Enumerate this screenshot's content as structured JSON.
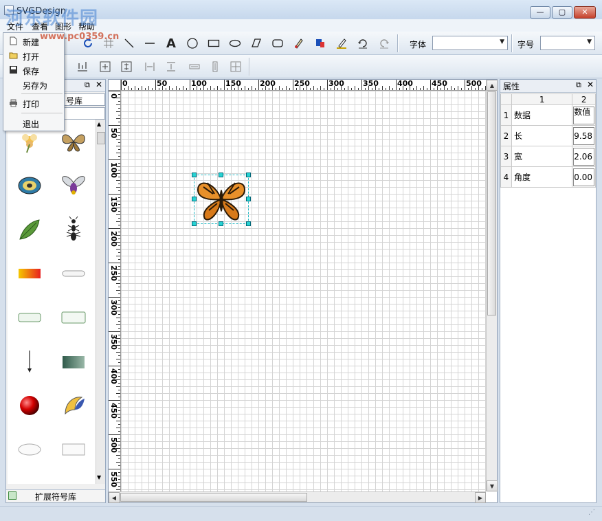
{
  "window": {
    "title": "SVGDesign",
    "min_glyph": "—",
    "max_glyph": "▢",
    "close_glyph": "✕"
  },
  "watermark": {
    "text": "河东软件园",
    "url": "www.pc0359.cn"
  },
  "menubar": {
    "items": [
      "文件",
      "查看",
      "图形",
      "帮助"
    ]
  },
  "toolbar": {
    "font_label": "字体",
    "font_value": "",
    "size_label": "字号",
    "size_value": ""
  },
  "file_menu": {
    "items": [
      {
        "label": "新建",
        "icon": "new-file-icon"
      },
      {
        "label": "打开",
        "icon": "open-folder-icon"
      },
      {
        "label": "保存",
        "icon": "save-disk-icon"
      },
      {
        "label": "另存为",
        "icon": ""
      },
      {
        "label": "打印",
        "icon": "printer-icon"
      },
      {
        "label": "退出",
        "icon": ""
      }
    ]
  },
  "library": {
    "tab_label": "号库",
    "footer_label": "扩展符号库",
    "symbols": [
      "flower",
      "butterfly",
      "disc",
      "fly",
      "leaf",
      "ant",
      "gradient-bar",
      "rounded-button",
      "small-button",
      "message-button",
      "arrow-down",
      "dark-green-rect",
      "red-ball",
      "swirl-graphic",
      "ellipse",
      "rectangle"
    ]
  },
  "rulers": {
    "h_ticks": [
      "0",
      "50",
      "100",
      "150",
      "200",
      "250",
      "300",
      "350",
      "400",
      "450",
      "500"
    ],
    "v_ticks": [
      "0",
      "50",
      "100",
      "150",
      "200",
      "250",
      "300",
      "350",
      "400",
      "450",
      "500",
      "550"
    ]
  },
  "properties": {
    "title": "属性",
    "col_headers": [
      "1",
      "2"
    ],
    "rows": [
      {
        "num": "1",
        "name": "数据",
        "value": "数值"
      },
      {
        "num": "2",
        "name": "长",
        "value": "9.58"
      },
      {
        "num": "3",
        "name": "宽",
        "value": "2.06"
      },
      {
        "num": "4",
        "name": "角度",
        "value": "0.00"
      }
    ]
  }
}
